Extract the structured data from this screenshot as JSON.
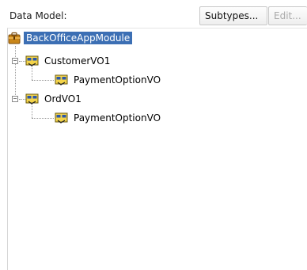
{
  "header": {
    "title": "Data Model:",
    "subtypes_label": "Subtypes...",
    "edit_label": "Edit..."
  },
  "tree": {
    "root": {
      "label": "BackOfficeAppModule",
      "icon": "application-module-icon"
    },
    "children": [
      {
        "label": "CustomerVO1",
        "icon": "view-object-icon",
        "expanded": true,
        "children": [
          {
            "label": "PaymentOptionVO",
            "icon": "view-link-icon"
          }
        ]
      },
      {
        "label": "OrdVO1",
        "icon": "view-object-icon",
        "expanded": true,
        "children": [
          {
            "label": "PaymentOptionVO",
            "icon": "view-link-icon"
          }
        ]
      }
    ]
  },
  "colors": {
    "selection": "#3c6fb4",
    "icon_yellow": "#f4d44a",
    "icon_blue": "#2b57a8"
  }
}
